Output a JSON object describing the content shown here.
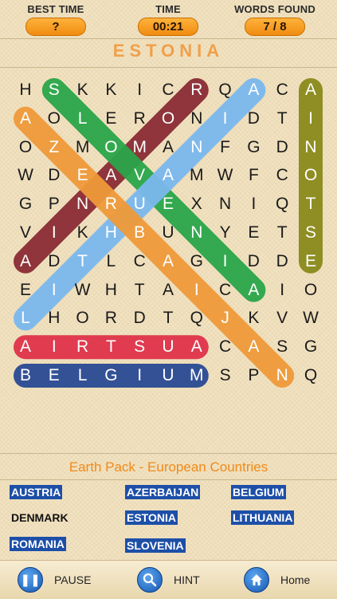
{
  "header": {
    "best_time_label": "BEST TIME",
    "best_time_value": "?",
    "time_label": "TIME",
    "time_value": "00:21",
    "words_found_label": "WORDS FOUND",
    "words_found_value": "7 / 8"
  },
  "current_word": "ESTONIA",
  "grid": {
    "rows": [
      "HSKKICRQACA",
      "AOLERONIDTI",
      "OZMOMANFGDN",
      "WDEAVAMWFCO",
      "GPNRUEXNIQT",
      "VIKHBUNYETS",
      "ADTLCAGIDDE",
      "EIWHTAICAIO",
      "LHORDTQJKVW",
      "AIRTSUACASG",
      "BELGIUMSPNQ"
    ],
    "found_paths": [
      {
        "word": "ESTONIA",
        "color": "#8a8a1c",
        "from": [
          6,
          10
        ],
        "to": [
          0,
          10
        ]
      },
      {
        "word": "AUSTRIA",
        "color": "#e0334a",
        "from": [
          9,
          6
        ],
        "to": [
          9,
          0
        ]
      },
      {
        "word": "BELGIUM",
        "color": "#2a4a94",
        "from": [
          10,
          0
        ],
        "to": [
          10,
          6
        ]
      },
      {
        "word": "ROMANIA",
        "color": "#8a2c34",
        "from": [
          0,
          6
        ],
        "to": [
          6,
          0
        ]
      },
      {
        "word": "SLOVENIA",
        "color": "#2aa64a",
        "from": [
          0,
          1
        ],
        "to": [
          7,
          8
        ]
      },
      {
        "word": "LITHUANIA",
        "color": "#7ab8ee",
        "from": [
          8,
          0
        ],
        "to": [
          0,
          8
        ]
      },
      {
        "word": "AZERBAIJAN",
        "color": "#ef9a3a",
        "from": [
          1,
          0
        ],
        "to": [
          10,
          9
        ]
      }
    ]
  },
  "pack_title": "Earth Pack - European Countries",
  "words": [
    {
      "label": "AUSTRIA",
      "found": true
    },
    {
      "label": "AZERBAIJAN",
      "found": true
    },
    {
      "label": "BELGIUM",
      "found": true
    },
    {
      "label": "DENMARK",
      "found": false
    },
    {
      "label": "ESTONIA",
      "found": true
    },
    {
      "label": "LITHUANIA",
      "found": true
    },
    {
      "label": "ROMANIA",
      "found": true
    },
    {
      "label": "SLOVENIA",
      "found": true
    }
  ],
  "buttons": {
    "pause_label": "PAUSE",
    "hint_label": "HINT",
    "home_label": "Home"
  },
  "icons": {
    "pause": "pause-icon",
    "hint": "magnifier-icon",
    "home": "home-icon"
  }
}
